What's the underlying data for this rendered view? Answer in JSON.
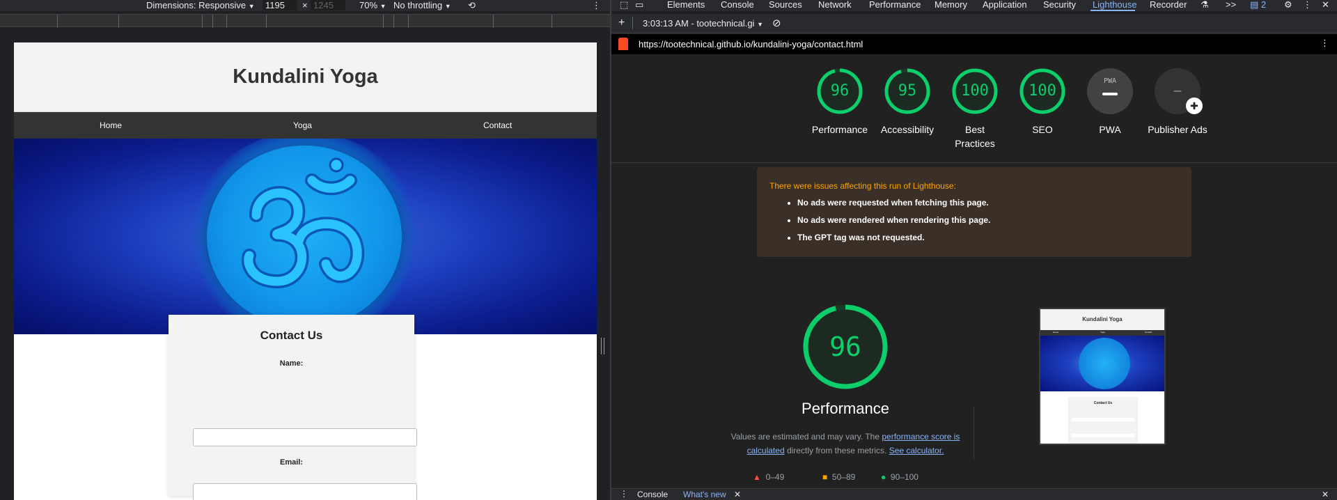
{
  "device_toolbar": {
    "dimensions_label": "Dimensions: Responsive",
    "width_value": "1195",
    "height_placeholder": "1245",
    "times_sign": "×",
    "zoom": "70%",
    "throttling": "No throttling"
  },
  "website": {
    "title": "Kundalini Yoga",
    "nav": [
      "Home",
      "Yoga",
      "Contact"
    ],
    "contact": {
      "title": "Contact Us",
      "name_label": "Name:",
      "email_label": "Email:"
    }
  },
  "devtools": {
    "tabs": [
      "Elements",
      "Console",
      "Sources",
      "Network",
      "Performance",
      "Memory",
      "Application",
      "Security",
      "Lighthouse",
      "Recorder"
    ],
    "active_tab": "Lighthouse",
    "more_tabs": ">>",
    "issues_count": "2",
    "report_selector": "3:03:13 AM - tootechnical.gi",
    "url": "https://tootechnical.github.io/kundalini-yoga/contact.html",
    "accent_color": "#8ab4f8",
    "pass_color": "#0cce6b",
    "average_color": "#ffa400",
    "fail_color": "#ff4e42"
  },
  "lighthouse": {
    "categories": [
      {
        "label": "Performance",
        "score": "96",
        "value": 0.96
      },
      {
        "label": "Accessibility",
        "score": "95",
        "value": 0.95
      },
      {
        "label": "Best Practices",
        "score": "100",
        "value": 1.0
      },
      {
        "label": "SEO",
        "score": "100",
        "value": 1.0
      },
      {
        "label": "PWA",
        "score": "PWA",
        "value": 0
      },
      {
        "label": "Publisher Ads",
        "score": "–",
        "value": 0
      }
    ],
    "warning": {
      "title": "There were issues affecting this run of Lighthouse:",
      "items": [
        "No ads were requested when fetching this page.",
        "No ads were rendered when rendering this page.",
        "The GPT tag was not requested."
      ]
    },
    "performance": {
      "score": "96",
      "value": 0.96,
      "label": "Performance",
      "desc_prefix": "Values are estimated and may vary. The",
      "desc_link1": "performance score is calculated",
      "desc_middle": "directly from these metrics.",
      "desc_link2": "See calculator."
    },
    "legend": [
      "0–49",
      "50–89",
      "90–100"
    ],
    "thumbnail": {
      "title": "Kundalini Yoga",
      "nav": [
        "Home",
        "Yoga",
        "Contact"
      ],
      "contact_title": "Contact Us"
    }
  },
  "drawer": {
    "tabs": [
      "Console",
      "What's new"
    ]
  }
}
